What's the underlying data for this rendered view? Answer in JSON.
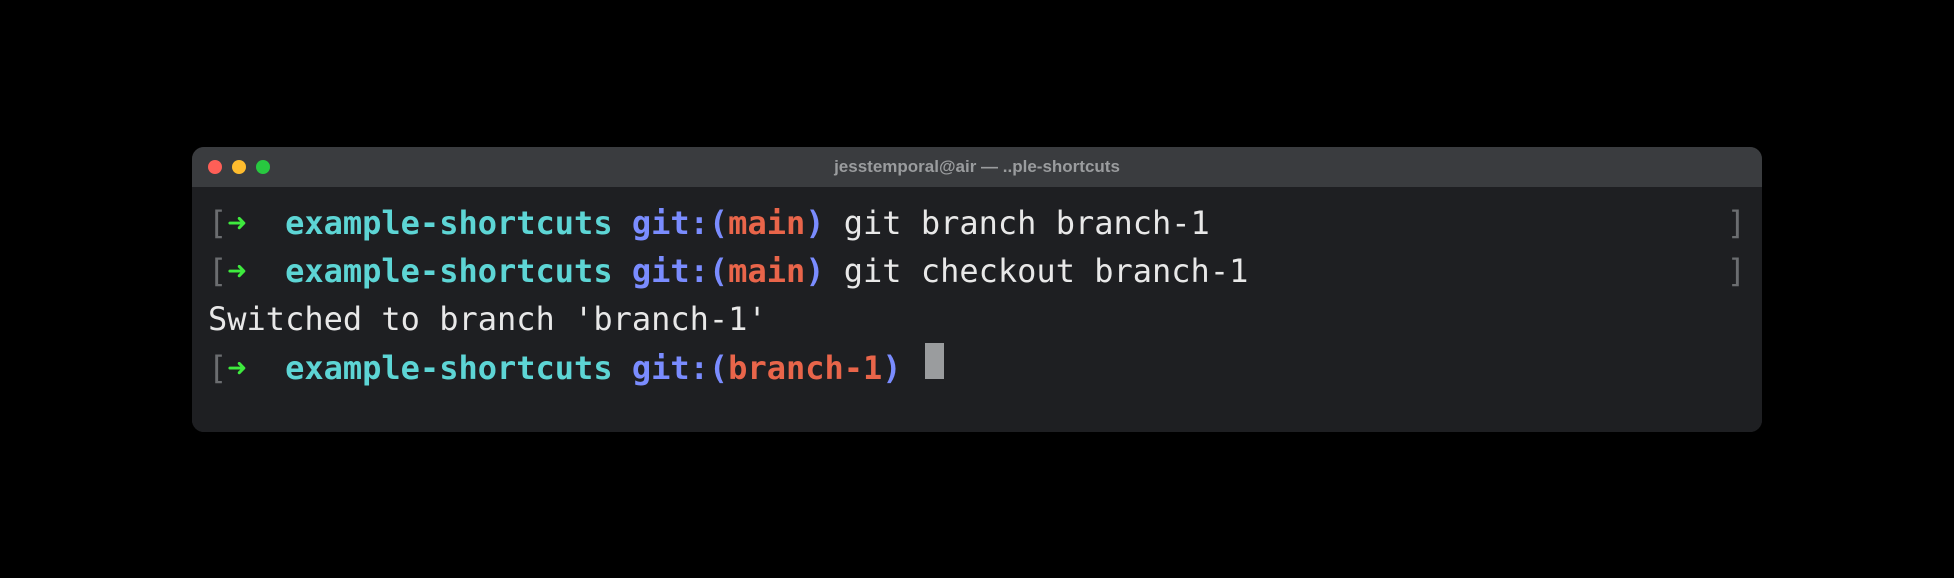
{
  "window": {
    "title": "jesstemporal@air — ..ple-shortcuts"
  },
  "prompt": {
    "arrow": "➜",
    "dir": "example-shortcuts",
    "git_label": "git:",
    "paren_open": "(",
    "paren_close": ")",
    "bracket_open": "[",
    "bracket_close": "]"
  },
  "lines": [
    {
      "branch": "main",
      "command": "git branch branch-1"
    },
    {
      "branch": "main",
      "command": "git checkout branch-1"
    }
  ],
  "output": {
    "text": "Switched to branch 'branch-1'"
  },
  "current_prompt": {
    "branch": "branch-1"
  }
}
